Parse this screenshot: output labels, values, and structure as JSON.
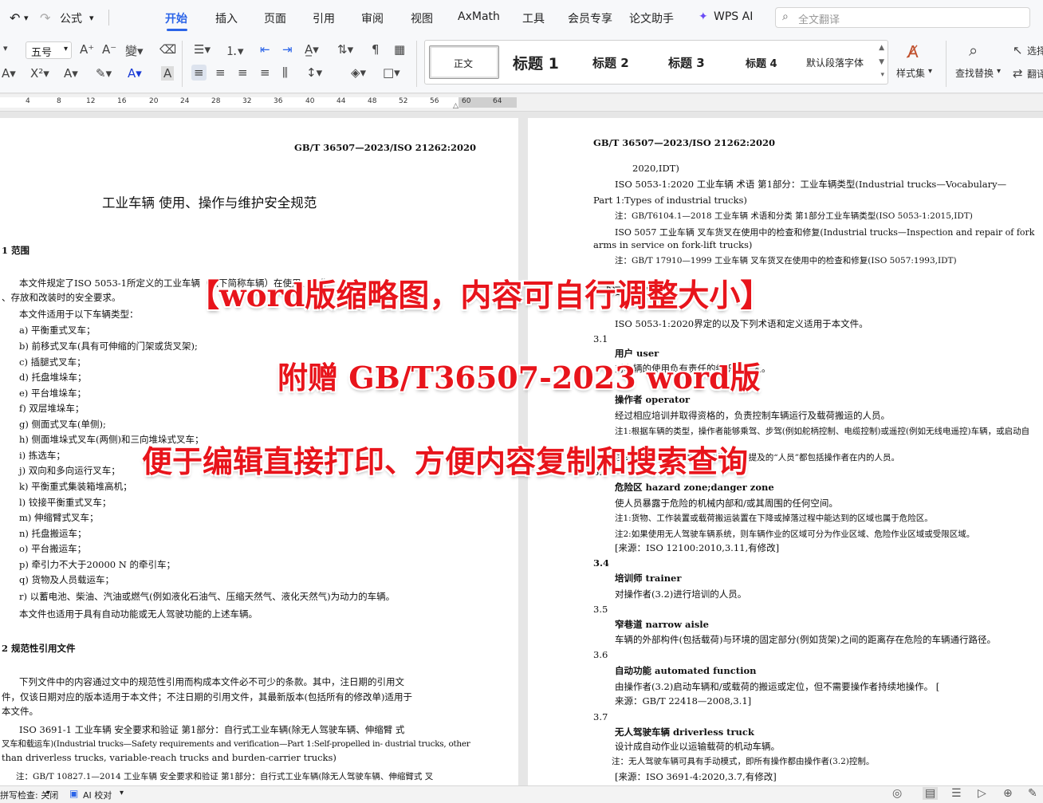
{
  "menubar": {
    "undo_icon": "↶",
    "redo_icon": "↷",
    "formula_label": "公式",
    "tabs": [
      "开始",
      "插入",
      "页面",
      "引用",
      "审阅",
      "视图",
      "AxMath",
      "工具",
      "会员专享",
      "论文助手",
      "WPS AI"
    ],
    "active_tab": "开始",
    "search_placeholder": "全文翻译"
  },
  "ribbon": {
    "font_size": "五号",
    "styles": [
      "正文",
      "标题 1",
      "标题 2",
      "标题 3",
      "标题 4",
      "默认段落字体"
    ],
    "styles_menu": "样式集",
    "find_replace": "查找替换",
    "select": "选择",
    "translate": "翻译"
  },
  "ruler": {
    "ticks": [
      "4",
      "8",
      "12",
      "16",
      "20",
      "24",
      "28",
      "32",
      "36",
      "40",
      "44",
      "48",
      "52",
      "56",
      "60",
      "64"
    ]
  },
  "left_page": {
    "header": "GB/T  36507—2023/ISO  21262:2020",
    "title": "工业车辆  使用、操作与维护安全规范",
    "sec1": "1  范围",
    "lines": [
      "本文件规定了ISO 5053-1所定义的工业车辆（以下简称车辆）在使用、操作",
      "、存放和改装时的安全要求。",
      "本文件适用于以下车辆类型：",
      "a)  平衡重式叉车；",
      "b)  前移式叉车(具有可伸缩的门架或货叉架);",
      "c)  插腿式叉车；",
      "d)  托盘堆垛车；",
      "e)  平台堆垛车；",
      "f)  双层堆垛车；",
      "g)  侧面式叉车(单侧);",
      "h)  侧面堆垛式叉车(两侧)和三向堆垛式叉车；",
      "i)  拣选车；",
      "j)  双向和多向运行叉车；",
      "k)  平衡重式集装箱堆高机；",
      "l)  铰接平衡重式叉车；",
      "m)  伸缩臂式叉车；",
      "n)  托盘搬运车；",
      "o)  平台搬运车；",
      "p)  牵引力不大于20000 N 的牵引车；",
      "q)  货物及人员载运车；",
      "r)  以蓄电池、柴油、汽油或燃气(例如液化石油气、压缩天然气、液化天然气)为动力的车辆。",
      "本文件也适用于具有自动功能或无人驾驶功能的上述车辆。"
    ],
    "sec2": "2  规范性引用文件",
    "lines2": [
      "下列文件中的内容通过文中的规范性引用而构成本文件必不可少的条款。其中，注日期的引用文",
      "件，仅该日期对应的版本适用于本文件；不注日期的引用文件，其最新版本(包括所有的修改单)适用于",
      "本文件。",
      "ISO 3691-1  工业车辆  安全要求和验证  第1部分：自行式工业车辆(除无人驾驶车辆、伸缩臂 式",
      "叉车和载运车)(Industrial trucks—Safety requirements and verification—Part 1:Self-propelled in- dustrial  trucks,  other",
      "than  driverless  trucks,  variable-reach  trucks  and  burden-carrier  trucks)",
      "注：GB/T 10827.1—2014  工业车辆  安全要求和验证  第1部分：自行式工业车辆(除无人驾驶车辆、伸缩臂式 叉"
    ]
  },
  "right_page": {
    "header": "GB/T   36507—2023/ISO   21262:2020",
    "lines": [
      "2020,IDT)",
      "ISO  5053-1:2020  工业车辆  术语  第1部分：工业车辆类型(Industrial trucks—Vocabulary—",
      "Part  1:Types  of  industrial  trucks)",
      "注：GB/T6104.1—2018  工业车辆  术语和分类  第1部分工业车辆类型(ISO 5053-1:2015,IDT)",
      "ISO  5057  工业车辆  叉车货叉在使用中的检查和修复(Industrial trucks—Inspection and repair of  fork",
      "arms  in  service  on  fork-lift  trucks)",
      "注：GB/T 17910—1999  工业车辆  叉车货叉在使用中的检查和修复(ISO 5057:1993,IDT)",
      "3  术语和定义",
      "ISO  5053-1:2020界定的以及下列术语和定义适用于本文件。",
      "3.1",
      "用户  user",
      "对车辆的使用负有责任的组织或个人。",
      "操作者  operator",
      "经过相应培训并取得资格的，负责控制车辆运行及载荷搬运的人员。",
      "注1:根据车辆的类型，操作者能够乘驾、步驾(例如舵柄控制、电缆控制)或遥控(例如无线电遥控)车辆，或启动自",
      "注2:在本文件中，除非另有说明，所提及的“人员”都包括操作者在内的人员。",
      "3.3",
      "危险区  hazard zone;danger zone",
      "使人员暴露于危险的机械内部和/或其周围的任何空间。",
      "注1:货物、工作装置或载荷搬运装置在下降或掉落过程中能达到的区域也属于危险区。",
      "注2:如果使用无人驾驶车辆系统，则车辆作业的区域可分为作业区域、危险作业区域或受限区域。",
      "[来源：ISO  12100:2010,3.11,有修改]",
      "3.4",
      "培训师  trainer",
      "对操作者(3.2)进行培训的人员。",
      "3.5",
      "窄巷道  narrow aisle",
      "车辆的外部构件(包括载荷)与环境的固定部分(例如货架)之间的距离存在危险的车辆通行路径。",
      "3.6",
      "自动功能  automated function",
      "由操作者(3.2)启动车辆和/或载荷的搬运或定位，但不需要操作者持续地操作。 [",
      "来源：GB/T   22418—2008,3.1]",
      "3.7",
      "无人驾驶车辆  driverless truck",
      "设计成自动作业以运输载荷的机动车辆。",
      "注：无人驾驶车辆可具有手动模式，即所有操作都由操作者(3.2)控制。",
      "[来源：ISO  3691-4:2020,3.7,有修改]"
    ]
  },
  "banner": {
    "line1": "【word版缩略图，内容可自行调整大小】",
    "line2": "附赠 GB/T36507-2023 word版",
    "line3": "便于编辑直接打印、方便内容复制和搜索查询",
    "color": "#e8141b"
  },
  "status": {
    "spell_check": "拼写检查: 关闭",
    "ai_proofread": "AI 校对"
  }
}
